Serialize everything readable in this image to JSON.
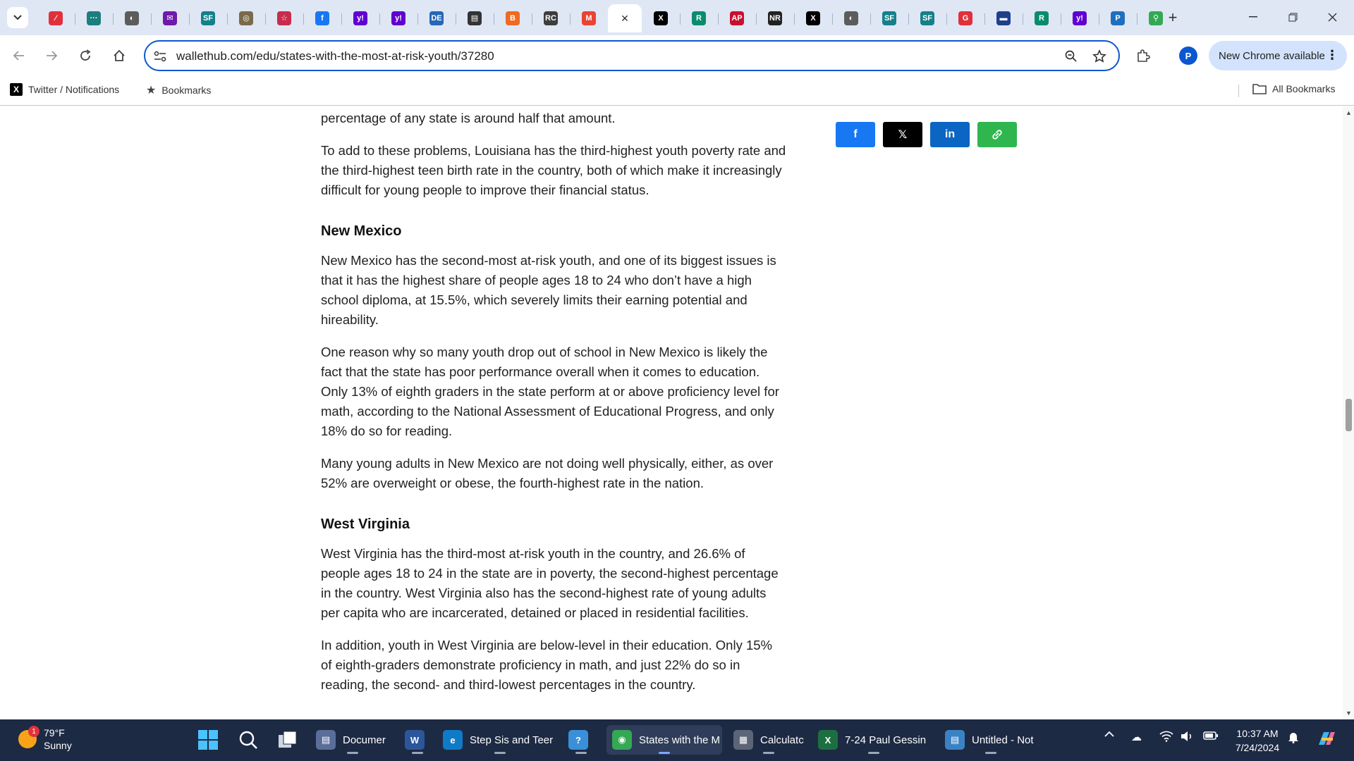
{
  "browser": {
    "tabs": [
      {
        "name": "tab-icon-1",
        "glyph": "⁄",
        "color": "#e0313b"
      },
      {
        "name": "tab-icon-2",
        "glyph": "···",
        "color": "#1c7e7e"
      },
      {
        "name": "tab-icon-3",
        "glyph": "◐",
        "color": "#5c5c5c"
      },
      {
        "name": "tab-icon-4",
        "glyph": "✉",
        "color": "#6e1ba8"
      },
      {
        "name": "tab-icon-5",
        "glyph": "SF",
        "color": "#14808a"
      },
      {
        "name": "tab-icon-6",
        "glyph": "◎",
        "color": "#7a6a4a"
      },
      {
        "name": "tab-icon-7",
        "glyph": "☆",
        "color": "#c72c4c"
      },
      {
        "name": "tab-icon-8",
        "glyph": "f",
        "color": "#1877f2"
      },
      {
        "name": "tab-icon-9",
        "glyph": "y!",
        "color": "#6001d2"
      },
      {
        "name": "tab-icon-10",
        "glyph": "y!",
        "color": "#6001d2"
      },
      {
        "name": "tab-icon-11",
        "glyph": "DE",
        "color": "#2767b4"
      },
      {
        "name": "tab-icon-12",
        "glyph": "▤",
        "color": "#333333"
      },
      {
        "name": "tab-icon-13",
        "glyph": "B",
        "color": "#f06a22"
      },
      {
        "name": "tab-icon-14",
        "glyph": "RC",
        "color": "#3d3d3d"
      },
      {
        "name": "tab-icon-15",
        "glyph": "M",
        "color": "#ea4335"
      },
      {
        "name": "tab-active-close",
        "glyph": "✕",
        "color": "#ffffff",
        "active": true
      },
      {
        "name": "tab-icon-17",
        "glyph": "X",
        "color": "#000000"
      },
      {
        "name": "tab-icon-18",
        "glyph": "R",
        "color": "#0a8c6c"
      },
      {
        "name": "tab-icon-19",
        "glyph": "AP",
        "color": "#c8102e"
      },
      {
        "name": "tab-icon-20",
        "glyph": "NR",
        "color": "#222222"
      },
      {
        "name": "tab-icon-21",
        "glyph": "X",
        "color": "#000000"
      },
      {
        "name": "tab-icon-22",
        "glyph": "◐",
        "color": "#5c5c5c"
      },
      {
        "name": "tab-icon-23",
        "glyph": "SF",
        "color": "#14808a"
      },
      {
        "name": "tab-icon-24",
        "glyph": "SF",
        "color": "#14808a"
      },
      {
        "name": "tab-icon-25",
        "glyph": "G",
        "color": "#e0313b"
      },
      {
        "name": "tab-icon-26",
        "glyph": "▬",
        "color": "#1e3f8a"
      },
      {
        "name": "tab-icon-27",
        "glyph": "R",
        "color": "#0a8c6c"
      },
      {
        "name": "tab-icon-28",
        "glyph": "y!",
        "color": "#6001d2"
      },
      {
        "name": "tab-icon-29",
        "glyph": "P",
        "color": "#1f6fbf"
      },
      {
        "name": "tab-icon-30",
        "glyph": "⚲",
        "color": "#34a853"
      }
    ],
    "url": "wallethub.com/edu/states-with-the-most-at-risk-youth/37280",
    "profile_initial": "P",
    "new_chrome_label": "New Chrome available",
    "bookmarks": {
      "twitter_label": "Twitter / Notifications",
      "bookmarks_label": "Bookmarks",
      "all_bookmarks_label": "All Bookmarks"
    }
  },
  "article": {
    "intro_tail": "percentage of any state is around half that amount.",
    "louisiana_p": "To add to these problems, Louisiana has the third-highest youth poverty rate and the third-highest teen birth rate in the country, both of which make it increasingly difficult for young people to improve their financial status.",
    "sections": [
      {
        "heading": "New Mexico",
        "paragraphs": [
          "New Mexico has the second-most at-risk youth, and one of its biggest issues is that it has the highest share of people ages 18 to 24 who don’t have a high school diploma, at 15.5%, which severely limits their earning potential and hireability.",
          "One reason why so many youth drop out of school in New Mexico is likely the fact that the state has poor performance overall when it comes to education. Only 13% of eighth graders in the state perform at or above proficiency level for math, according to the National Assessment of Educational Progress, and only 18% do so for reading.",
          "Many young adults in New Mexico are not doing well physically, either, as over 52% are overweight or obese, the fourth-highest rate in the nation."
        ]
      },
      {
        "heading": "West Virginia",
        "paragraphs": [
          "West Virginia has the third-most at-risk youth in the country, and 26.6% of people ages 18 to 24 in the state are in poverty, the second-highest percentage in the country. West Virginia also has the second-highest rate of young adults per capita who are incarcerated, detained or placed in residential facilities.",
          "In addition, youth in West Virginia are below-level in their education. Only 15% of eighth-graders demonstrate proficiency in math, and just 22% do so in reading, the second- and third-lowest percentages in the country."
        ]
      }
    ],
    "share": {
      "facebook": "f",
      "x": "𝕏",
      "linkedin": "in",
      "link": "🔗"
    }
  },
  "taskbar": {
    "weather": {
      "temp": "79°F",
      "condition": "Sunny",
      "badge": "1"
    },
    "items": [
      {
        "name": "taskbar-documents",
        "label": "Documer",
        "icon": "▤",
        "color": "#5a6e9a"
      },
      {
        "name": "taskbar-word",
        "label": "",
        "icon": "W",
        "color": "#2b579a"
      },
      {
        "name": "taskbar-edge",
        "label": "Step Sis and Teer",
        "icon": "e",
        "color": "#0f7bc7"
      },
      {
        "name": "taskbar-help",
        "label": "",
        "icon": "?",
        "color": "#3a8fd9"
      },
      {
        "name": "taskbar-chrome",
        "label": "States with the M",
        "icon": "◉",
        "color": "#34a853"
      },
      {
        "name": "taskbar-calculator",
        "label": "Calculatc",
        "icon": "▦",
        "color": "#5b6577"
      },
      {
        "name": "taskbar-excel",
        "label": "7-24 Paul Gessin",
        "icon": "X",
        "color": "#1d6f42"
      },
      {
        "name": "taskbar-notepad",
        "label": "Untitled - Not",
        "icon": "▤",
        "color": "#3b82c4"
      }
    ],
    "time": "10:37 AM",
    "date": "7/24/2024"
  }
}
